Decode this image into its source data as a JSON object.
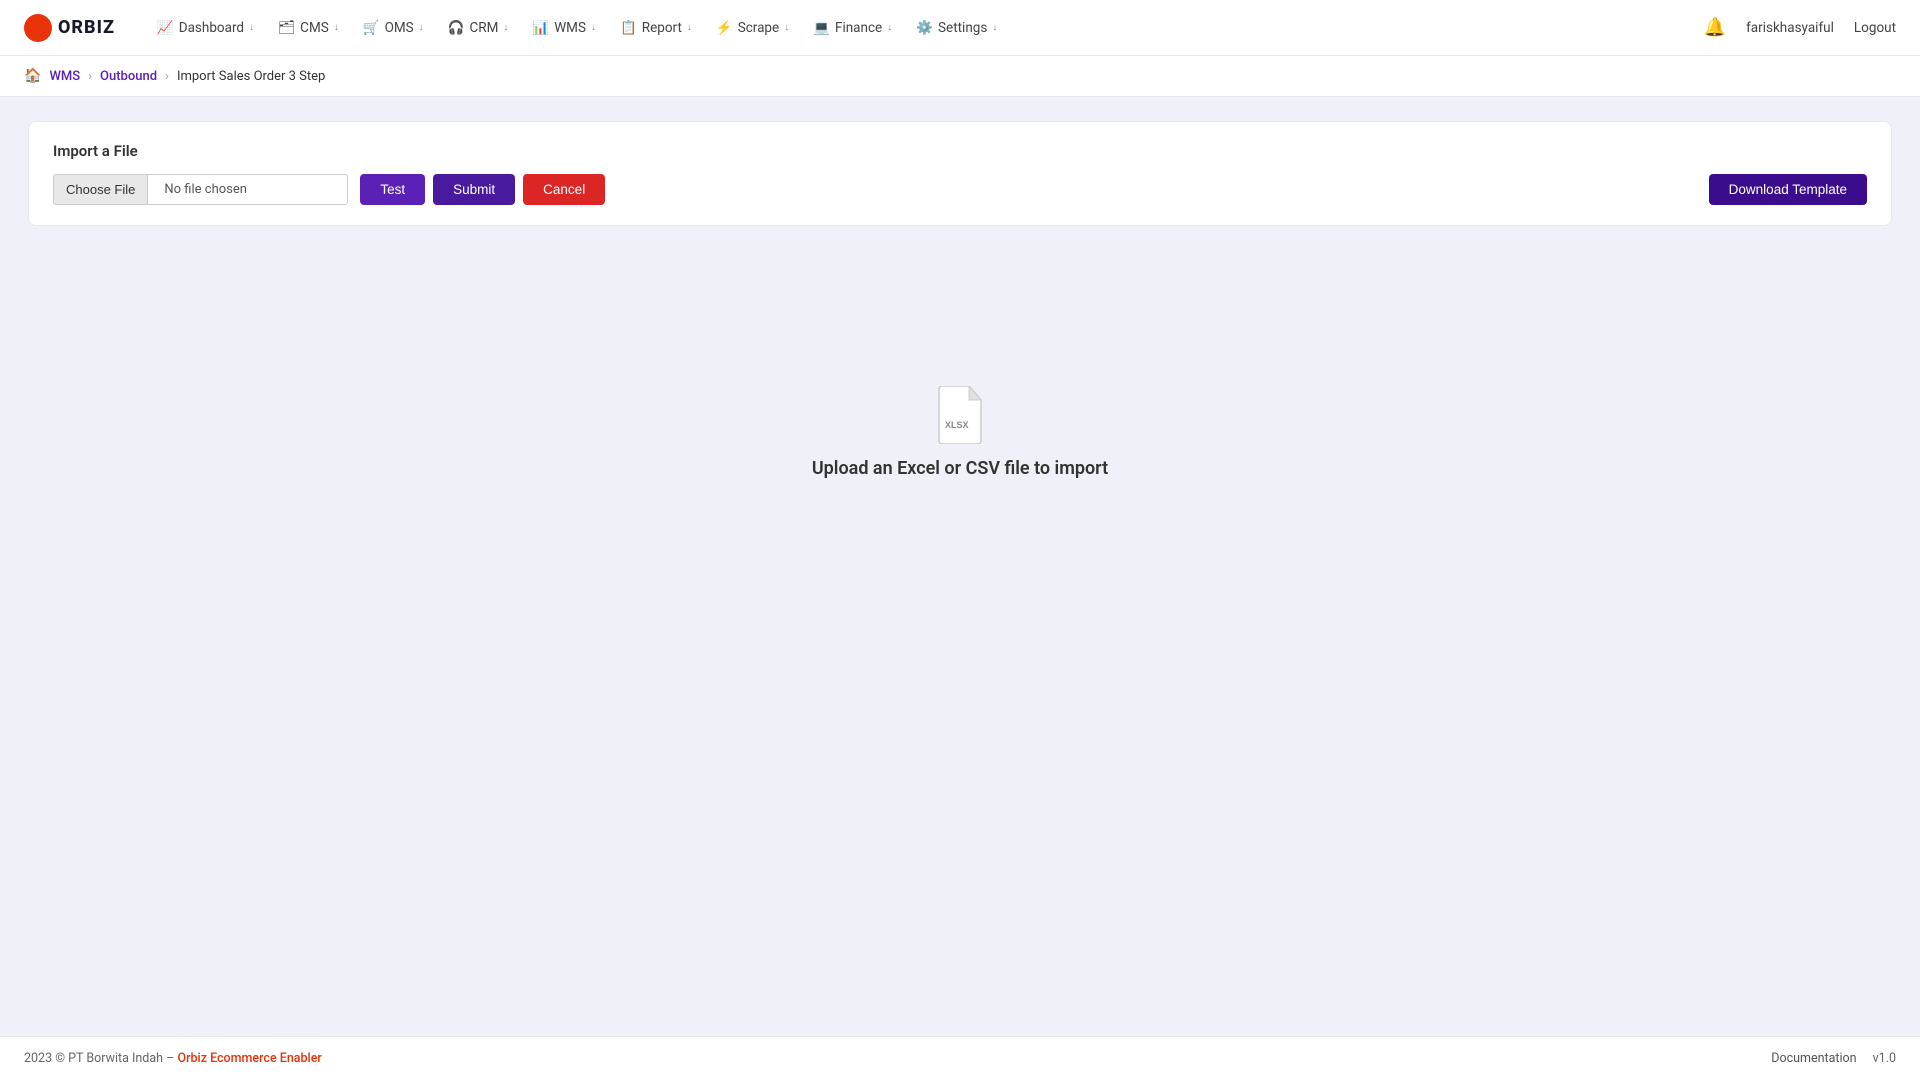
{
  "logo": {
    "text": "ORBIZ"
  },
  "nav": {
    "items": [
      {
        "label": "Dashboard",
        "icon": "chart-icon"
      },
      {
        "label": "CMS",
        "icon": "cms-icon"
      },
      {
        "label": "OMS",
        "icon": "oms-icon"
      },
      {
        "label": "CRM",
        "icon": "crm-icon"
      },
      {
        "label": "WMS",
        "icon": "wms-icon"
      },
      {
        "label": "Report",
        "icon": "report-icon"
      },
      {
        "label": "Scrape",
        "icon": "scrape-icon"
      },
      {
        "label": "Finance",
        "icon": "finance-icon"
      },
      {
        "label": "Settings",
        "icon": "settings-icon"
      }
    ],
    "username": "fariskhasyaiful",
    "logout_label": "Logout"
  },
  "breadcrumb": {
    "items": [
      {
        "label": "WMS",
        "link": true
      },
      {
        "label": "Outbound",
        "link": true
      },
      {
        "label": "Import Sales Order 3 Step",
        "link": false
      }
    ]
  },
  "import": {
    "title": "Import a File",
    "file_button": "Choose File",
    "file_placeholder": "No file chosen",
    "btn_test": "Test",
    "btn_submit": "Submit",
    "btn_cancel": "Cancel",
    "btn_download": "Download Template"
  },
  "upload_area": {
    "label": "Upload an Excel or CSV file to import"
  },
  "footer": {
    "copyright": "2023 © PT Borwita Indah –",
    "brand": "Orbiz Ecommerce Enabler",
    "doc_label": "Documentation",
    "version": "v1.0"
  }
}
